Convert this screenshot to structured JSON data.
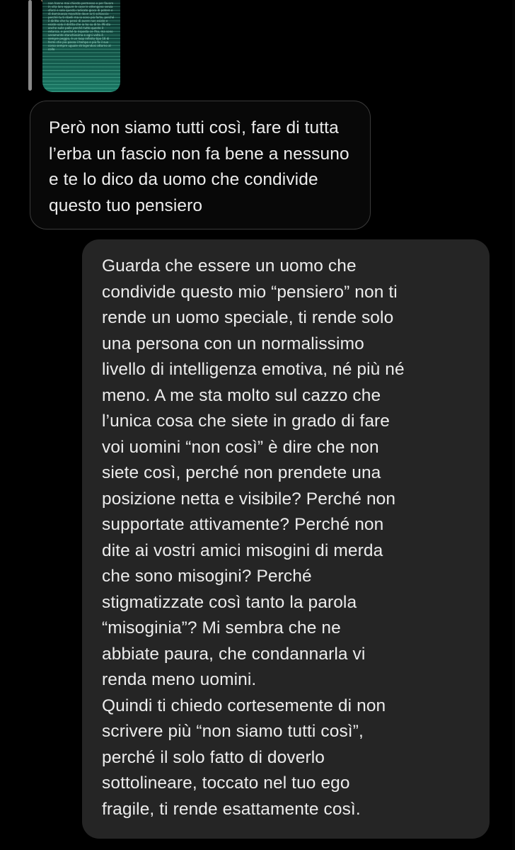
{
  "quoted_message": {
    "image_text": "non hanno mai chiesto permesso o per favore in vita loro eppure le cose le ottengono senza sforzi e solo questo radicato gioco di potere e di dominanza maschile dove io ti schiaccio perché tu ti ribelli ma io sono più forte, perché il diritto che tu pensi di avere non esiste e esiste solo il diritto che io ho su di te. Mi sto anche sulle palle perché tutto questo è retorica, e perché la risposta ce l'ho, ma sono veramente stanchissima e ogni volta è sempre peggio, è un loop infinito tipo 16 di fermi che più passa il tempo e più fa il suo corso sempre uguale stringendosi attorno al collo"
  },
  "messages": [
    {
      "direction": "incoming",
      "lines": [
        "Però non siamo tutti così, fare di tutta",
        "l’erba un fascio non fa bene a nessuno",
        "e te lo dico da uomo che condivide",
        "questo tuo pensiero"
      ]
    },
    {
      "direction": "outgoing",
      "lines": [
        "Guarda che essere un uomo che",
        "condivide questo mio “pensiero” non ti",
        "rende un uomo speciale, ti rende solo",
        "una persona con un normalissimo",
        "livello di intelligenza emotiva, né più né",
        "meno. A me sta molto sul cazzo che",
        "l’unica cosa che siete in grado di fare",
        "voi uomini “non così” è dire che non",
        "siete così, perché non prendete una",
        "posizione netta e visibile? Perché non",
        "supportate attivamente? Perché non",
        "dite ai vostri amici misogini di merda",
        "che sono misogini? Perché",
        "stigmatizzate così tanto la parola",
        "“misoginia”? Mi sembra che ne",
        "abbiate paura, che condannarla vi",
        "renda meno uomini.",
        "Quindi ti chiedo cortesemente di non",
        "scrivere più “non siamo tutti così”,",
        "perché il solo fatto di doverlo",
        "sottolineare, toccato nel tuo ego",
        "fragile, ti rende esattamente così."
      ]
    }
  ],
  "colors": {
    "background": "#000000",
    "incoming_bubble": "#080808",
    "incoming_border": "#3a3a3a",
    "outgoing_bubble": "#252525",
    "text": "#ececec",
    "quoted_image": "#145c4e"
  }
}
